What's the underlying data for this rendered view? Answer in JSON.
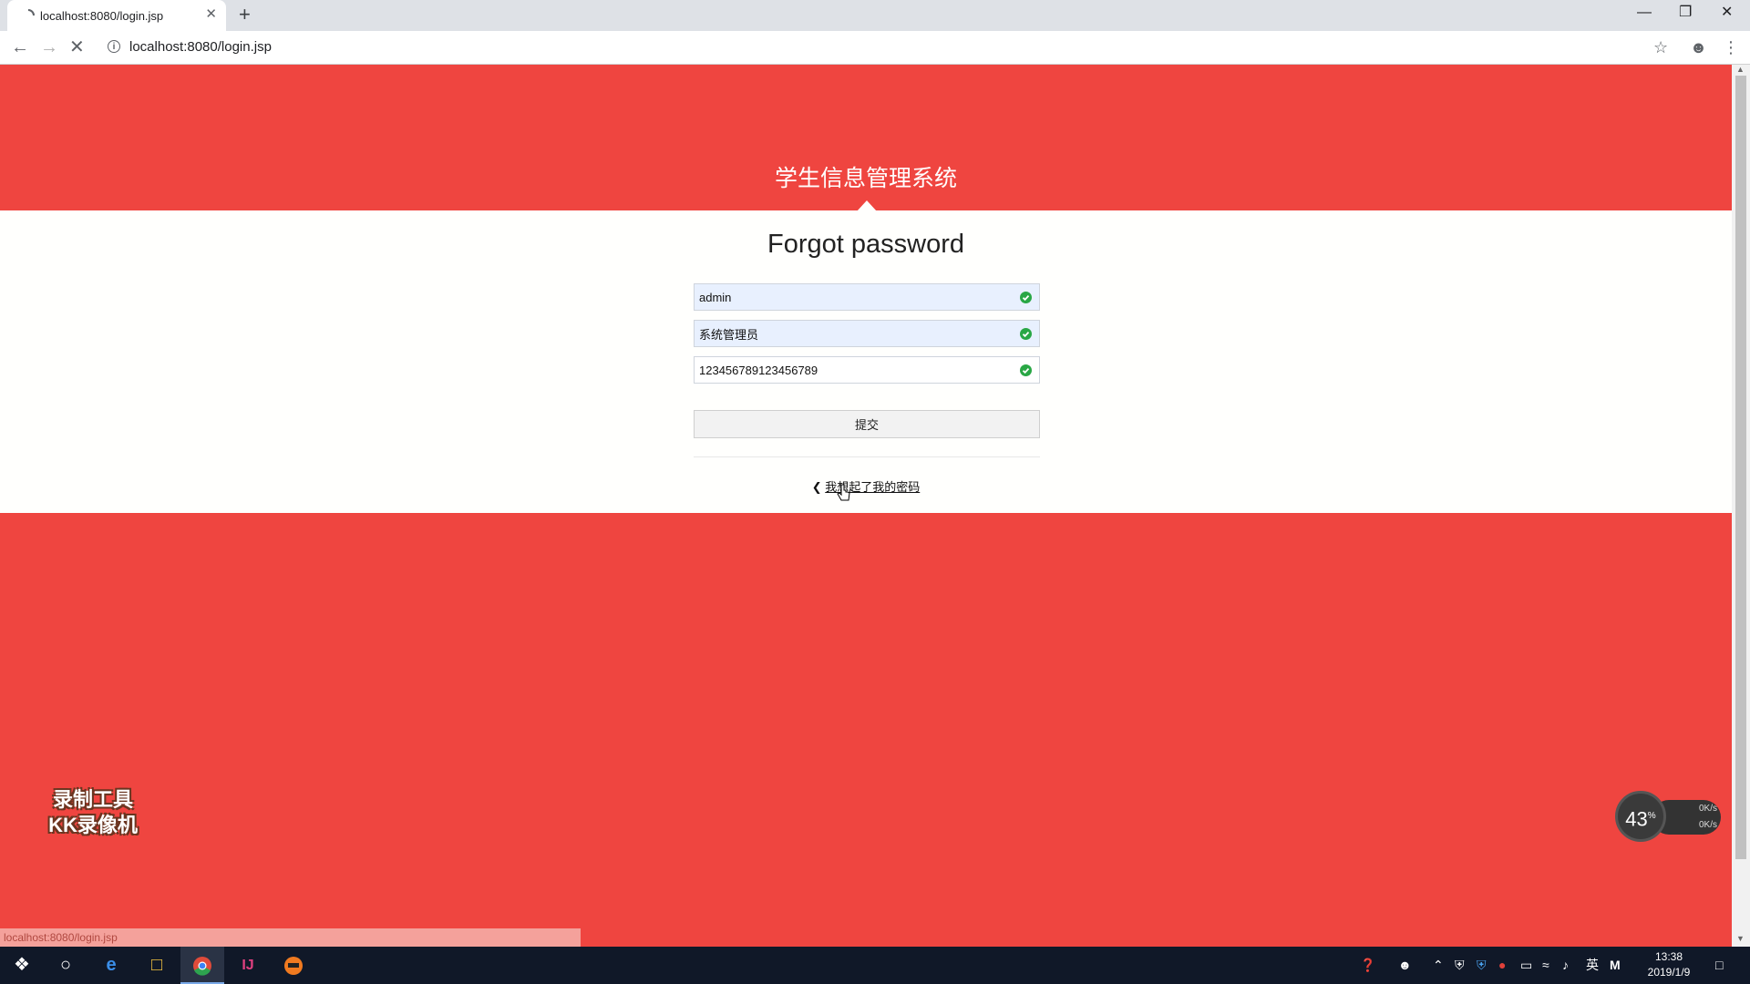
{
  "browser": {
    "tab_title": "localhost:8080/login.jsp",
    "tab_close": "✕",
    "new_tab": "+",
    "url": "localhost:8080/login.jsp",
    "status_url": "localhost:8080/login.jsp"
  },
  "header": {
    "site_title": "学生信息管理系统"
  },
  "form": {
    "title": "Forgot password",
    "fields": [
      {
        "value": "admin"
      },
      {
        "value": "系统管理员"
      },
      {
        "value": "123456789123456789"
      }
    ],
    "submit_label": "提交",
    "back_link_label": "我想起了我的密码"
  },
  "overlays": {
    "watermark_line1": "录制工具",
    "watermark_line2": "KK录像机",
    "net_percent": "43",
    "net_percent_unit": "%",
    "net_up": "0K/s",
    "net_down": "0K/s"
  },
  "taskbar": {
    "time": "13:38",
    "date": "2019/1/9",
    "ime": "英"
  },
  "colors": {
    "brand_red": "#ef4540",
    "check_green": "#29a745",
    "autofill_blue": "#e8f0fe"
  }
}
